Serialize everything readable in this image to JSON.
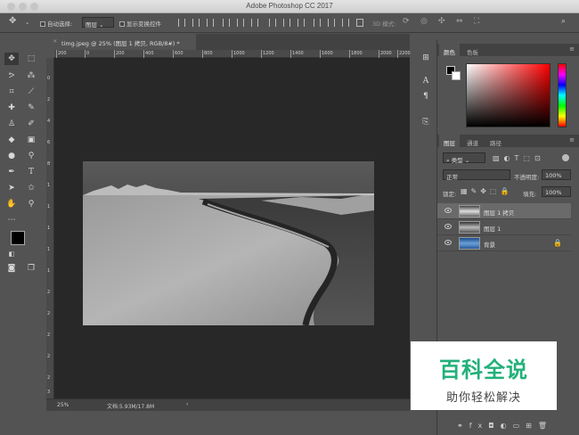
{
  "window": {
    "title": "Adobe Photoshop CC 2017"
  },
  "options_bar": {
    "auto_select_label": "自动选择:",
    "auto_select_value": "图层",
    "show_transform_label": "显示变换控件",
    "mode_3d_label": "3D 模式:"
  },
  "document": {
    "tab_title": "timg.jpeg @ 25% (图层 1 拷贝, RGB/8#) *",
    "zoom": "25%",
    "doc_size": "文档:5.93M/17.8M"
  },
  "ruler": {
    "ticks": [
      "200",
      "0",
      "200",
      "400",
      "600",
      "800",
      "1000",
      "1200",
      "1400",
      "1600",
      "1800",
      "2000",
      "2200"
    ],
    "vticks": [
      "0",
      "2",
      "4",
      "6",
      "8",
      "1",
      "1",
      "1",
      "1",
      "1",
      "2",
      "2",
      "2",
      "2",
      "2",
      "3"
    ]
  },
  "color_panel": {
    "tabs": [
      "颜色",
      "色板"
    ]
  },
  "layers_panel": {
    "tabs": [
      "图层",
      "通道",
      "路径"
    ],
    "filter_label": "类型",
    "blend_mode": "正常",
    "opacity_label": "不透明度:",
    "opacity_value": "100%",
    "lock_label": "锁定:",
    "fill_label": "填充:",
    "fill_value": "100%",
    "layers": [
      {
        "name": "图层 1 拷贝",
        "active": true
      },
      {
        "name": "图层 1",
        "active": false
      },
      {
        "name": "背景",
        "active": false
      }
    ]
  },
  "watermark": {
    "line1": "百科全说",
    "line2": "助你轻松解决"
  }
}
